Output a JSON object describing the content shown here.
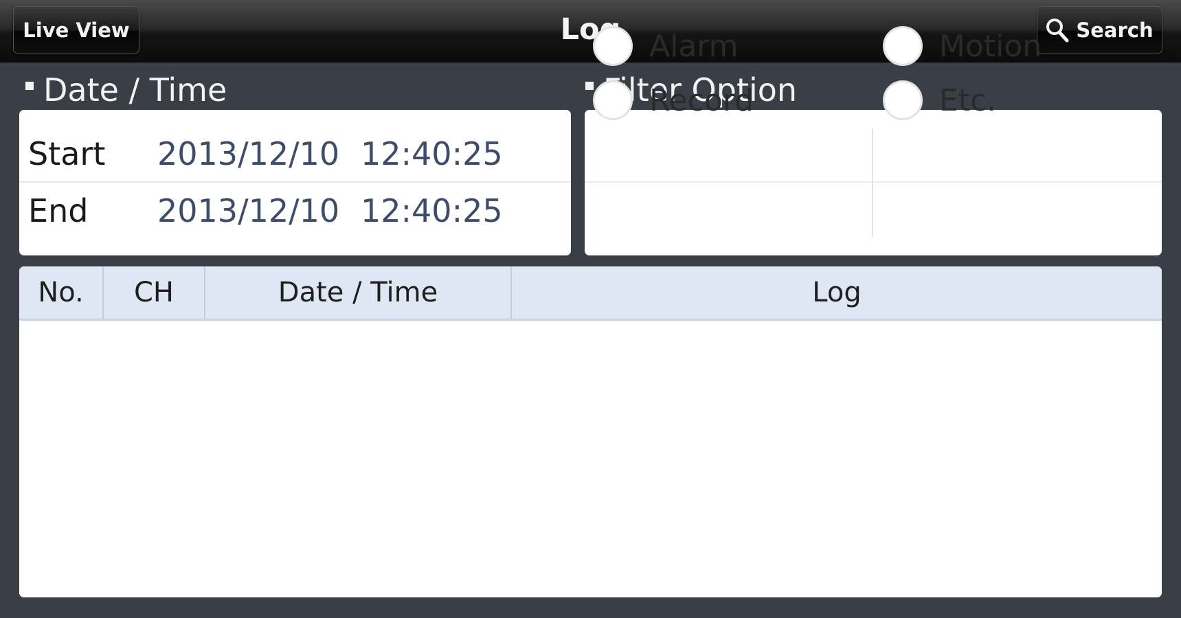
{
  "header": {
    "title": "Log",
    "live_view_label": "Live View",
    "search_label": "Search"
  },
  "date_time": {
    "section_label": "Date / Time",
    "start": {
      "label": "Start",
      "date": "2013/12/10",
      "time": "12:40:25"
    },
    "end": {
      "label": "End",
      "date": "2013/12/10",
      "time": "12:40:25"
    }
  },
  "filter": {
    "section_label": "Filter Option",
    "options": [
      {
        "label": "Alarm",
        "checked": false
      },
      {
        "label": "Motion",
        "checked": false
      },
      {
        "label": "Record",
        "checked": false
      },
      {
        "label": "Etc.",
        "checked": false
      }
    ]
  },
  "log_table": {
    "columns": [
      "No.",
      "CH",
      "Date / Time",
      "Log"
    ],
    "rows": []
  },
  "colors": {
    "background": "#3a3f47",
    "header_row": "#dfe7f5",
    "datetime_value": "#3e4c68"
  },
  "icons": {
    "search": "search-icon"
  }
}
